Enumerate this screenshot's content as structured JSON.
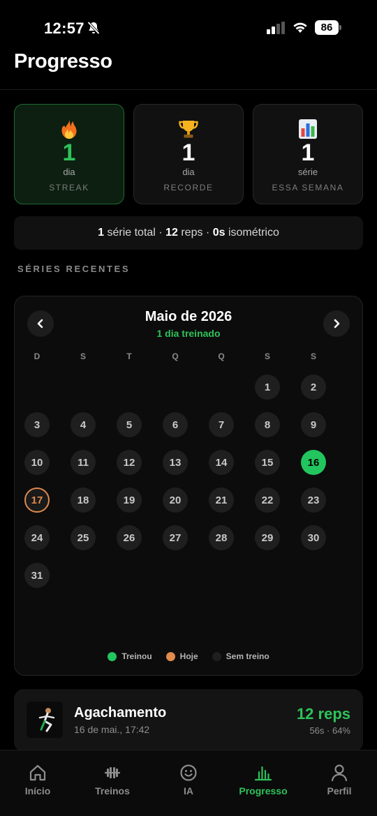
{
  "status_bar": {
    "time": "12:57",
    "battery": "86"
  },
  "header": {
    "title": "Progresso"
  },
  "stats": [
    {
      "icon": "fire-icon",
      "value": "1",
      "unit": "dia",
      "label": "STREAK"
    },
    {
      "icon": "trophy-icon",
      "value": "1",
      "unit": "dia",
      "label": "RECORDE"
    },
    {
      "icon": "bar-chart-icon",
      "value": "1",
      "unit": "série",
      "label": "ESSA SEMANA"
    }
  ],
  "summary": {
    "series_count": "1",
    "series_label": "série total",
    "reps_count": "12",
    "reps_label": "reps",
    "iso_value": "0s",
    "iso_label": "isométrico",
    "separator": "·"
  },
  "section_title": "SÉRIES RECENTES",
  "calendar": {
    "prev_label": "‹",
    "next_label": "›",
    "month_title": "Maio de 2026",
    "subtitle": "1 dia treinado",
    "weekdays": [
      "D",
      "S",
      "T",
      "Q",
      "Q",
      "S",
      "S"
    ],
    "days": [
      "1",
      "2",
      "3",
      "4",
      "5",
      "6",
      "7",
      "8",
      "9",
      "10",
      "11",
      "12",
      "13",
      "14",
      "15",
      "16",
      "17",
      "18",
      "19",
      "20",
      "21",
      "22",
      "23",
      "24",
      "25",
      "26",
      "27",
      "28",
      "29",
      "30",
      "31"
    ],
    "trained_day": "16",
    "today": "17",
    "legend": {
      "trained": "Treinou",
      "today": "Hoje",
      "none": "Sem treino"
    }
  },
  "recent_workouts": [
    {
      "name": "Agachamento",
      "date": "16 de mai., 17:42",
      "reps": "12 reps",
      "meta": "56s · 64%"
    }
  ],
  "tabs": [
    {
      "label": "Início",
      "icon": "home-icon"
    },
    {
      "label": "Treinos",
      "icon": "dumbbell-icon"
    },
    {
      "label": "IA",
      "icon": "smiley-icon"
    },
    {
      "label": "Progresso",
      "icon": "progress-chart-icon",
      "active": true
    },
    {
      "label": "Perfil",
      "icon": "user-icon"
    }
  ],
  "colors": {
    "accent_green": "#22c55e",
    "today_orange": "#e08a4c",
    "background": "#000000",
    "card": "#111111"
  }
}
